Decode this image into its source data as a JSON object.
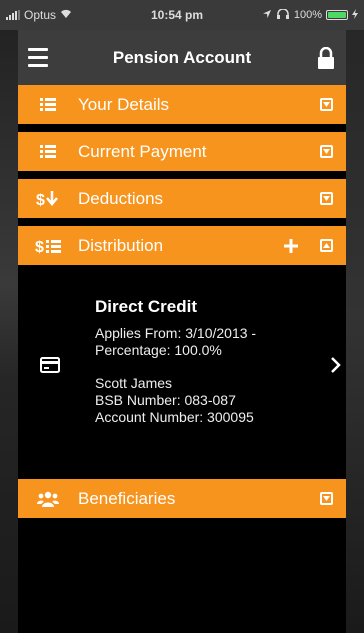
{
  "status_bar": {
    "carrier": "Optus",
    "time": "10:54 pm",
    "battery": "100%"
  },
  "header": {
    "title": "Pension Account",
    "menu_icon": "hamburger-icon",
    "lock_icon": "lock-icon"
  },
  "sections": [
    {
      "label": "Your Details",
      "icon": "list-icon",
      "expanded": false
    },
    {
      "label": "Current Payment",
      "icon": "list-icon",
      "expanded": false
    },
    {
      "label": "Deductions",
      "icon": "dollar-arrow-icon",
      "expanded": false
    },
    {
      "label": "Distribution",
      "icon": "dollar-list-icon",
      "expanded": true
    },
    {
      "label": "Beneficiaries",
      "icon": "users-icon",
      "expanded": false
    }
  ],
  "distribution": {
    "title": "Direct Credit",
    "applies_from": "Applies From: 3/10/2013 -",
    "percentage": "Percentage: 100.0%",
    "name": "Scott James",
    "bsb": "BSB Number: 083-087",
    "account": "Account Number: 300095"
  },
  "colors": {
    "section_orange": "#f7941d",
    "header_gray": "#3d3d3d",
    "background": "#000000"
  }
}
